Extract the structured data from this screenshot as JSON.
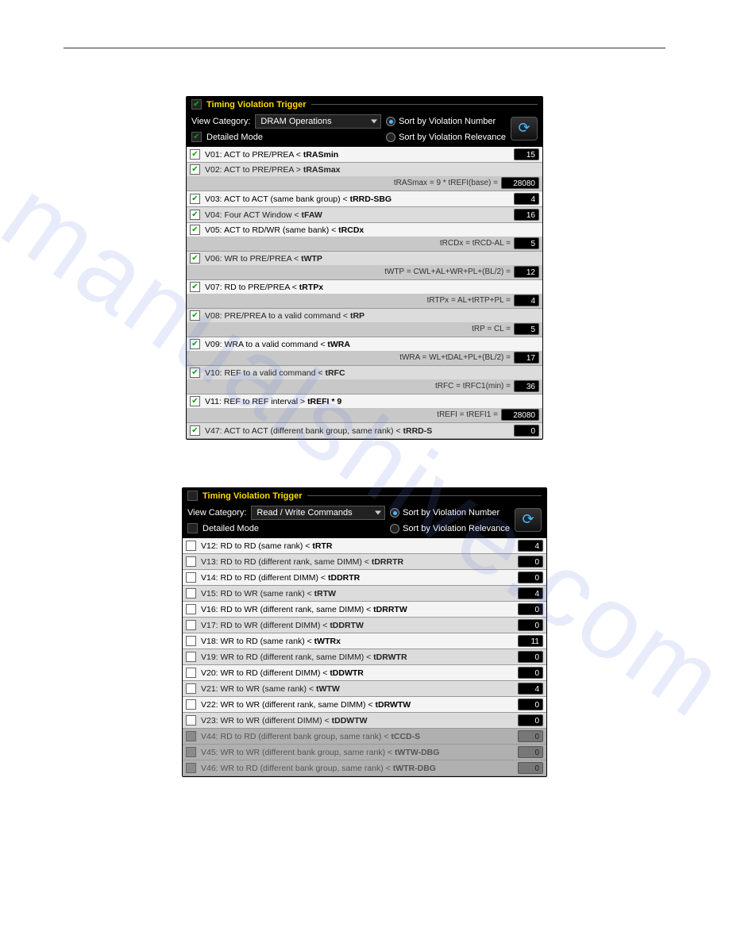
{
  "panel1": {
    "title_checked": true,
    "title": "Timing Violation Trigger",
    "view_label": "View Category:",
    "view_value": "DRAM Operations",
    "sort_num": "Sort by Violation Number",
    "sort_rel": "Sort by Violation Relevance",
    "sort_sel": "num",
    "detailed_label": "Detailed Mode",
    "detailed_checked": true,
    "rows": [
      {
        "c": true,
        "lbl": "V01: ACT to PRE/PREA <",
        "p": "tRASmin",
        "v": "15"
      },
      {
        "c": true,
        "lbl": "V02: ACT to PRE/PREA >",
        "p": "tRASmax",
        "f": "tRASmax = 9 * tREFI(base) =",
        "v": "28080",
        "wide": true
      },
      {
        "c": true,
        "lbl": "V03: ACT to ACT (same bank group) <",
        "p": "tRRD-SBG",
        "v": "4"
      },
      {
        "c": true,
        "lbl": "V04: Four ACT Window <",
        "p": "tFAW",
        "v": "16"
      },
      {
        "c": true,
        "lbl": "V05: ACT to RD/WR (same bank) <",
        "p": "tRCDx",
        "f": "tRCDx = tRCD-AL =",
        "v": "5"
      },
      {
        "c": true,
        "lbl": "V06: WR to PRE/PREA <",
        "p": "tWTP",
        "f": "tWTP = CWL+AL+WR+PL+(BL/2) =",
        "v": "12"
      },
      {
        "c": true,
        "lbl": "V07: RD to PRE/PREA <",
        "p": "tRTPx",
        "f": "tRTPx = AL+tRTP+PL =",
        "v": "4"
      },
      {
        "c": true,
        "lbl": "V08: PRE/PREA to a valid command <",
        "p": "tRP",
        "f": "tRP = CL =",
        "v": "5"
      },
      {
        "c": true,
        "lbl": "V09: WRA to a valid command <",
        "p": "tWRA",
        "f": "tWRA = WL+tDAL+PL+(BL/2) =",
        "v": "17"
      },
      {
        "c": true,
        "lbl": "V10: REF to a valid command <",
        "p": "tRFC",
        "f": "tRFC = tRFC1(min) =",
        "v": "36"
      },
      {
        "c": true,
        "lbl": "V11: REF to REF interval >",
        "p": "tREFI * 9",
        "f": "tREFI = tREFI1 =",
        "v": "28080",
        "wide": true
      },
      {
        "c": true,
        "lbl": "V47: ACT to ACT (different bank group, same rank) <",
        "p": "tRRD-S",
        "v": "0"
      }
    ]
  },
  "panel2": {
    "title_checked": false,
    "title": "Timing Violation Trigger",
    "view_label": "View Category:",
    "view_value": "Read / Write Commands",
    "sort_num": "Sort by Violation Number",
    "sort_rel": "Sort by Violation Relevance",
    "sort_sel": "num",
    "detailed_label": "Detailed Mode",
    "detailed_checked": false,
    "rows": [
      {
        "c": false,
        "lbl": "V12: RD to RD (same rank) <",
        "p": "tRTR",
        "v": "4"
      },
      {
        "c": false,
        "lbl": "V13: RD to RD (different rank, same DIMM) <",
        "p": "tDRRTR",
        "v": "0"
      },
      {
        "c": false,
        "lbl": "V14: RD to RD (different DIMM) <",
        "p": "tDDRTR",
        "v": "0"
      },
      {
        "c": false,
        "lbl": "V15: RD to WR (same rank) <",
        "p": "tRTW",
        "v": "4"
      },
      {
        "c": false,
        "lbl": "V16: RD to WR (different rank, same DIMM) <",
        "p": "tDRRTW",
        "v": "0"
      },
      {
        "c": false,
        "lbl": "V17: RD to WR (different DIMM) <",
        "p": "tDDRTW",
        "v": "0"
      },
      {
        "c": false,
        "lbl": "V18: WR to RD (same rank) <",
        "p": "tWTRx",
        "v": "11"
      },
      {
        "c": false,
        "lbl": "V19: WR to RD (different rank, same DIMM) <",
        "p": "tDRWTR",
        "v": "0"
      },
      {
        "c": false,
        "lbl": "V20: WR to RD (different DIMM) <",
        "p": "tDDWTR",
        "v": "0"
      },
      {
        "c": false,
        "lbl": "V21: WR to WR (same rank) <",
        "p": "tWTW",
        "v": "4"
      },
      {
        "c": false,
        "lbl": "V22: WR to WR (different rank, same DIMM) <",
        "p": "tDRWTW",
        "v": "0"
      },
      {
        "c": false,
        "lbl": "V23: WR to WR (different DIMM) <",
        "p": "tDDWTW",
        "v": "0"
      },
      {
        "c": false,
        "lbl": "V44: RD to RD (different bank group, same rank) <",
        "p": "tCCD-S",
        "v": "0",
        "dim": true
      },
      {
        "c": false,
        "lbl": "V45: WR to WR (different bank group, same rank) <",
        "p": "tWTW-DBG",
        "v": "0",
        "dim": true
      },
      {
        "c": false,
        "lbl": "V46: WR to RD (different bank group, same rank) <",
        "p": "tWTR-DBG",
        "v": "0",
        "dim": true
      }
    ]
  }
}
